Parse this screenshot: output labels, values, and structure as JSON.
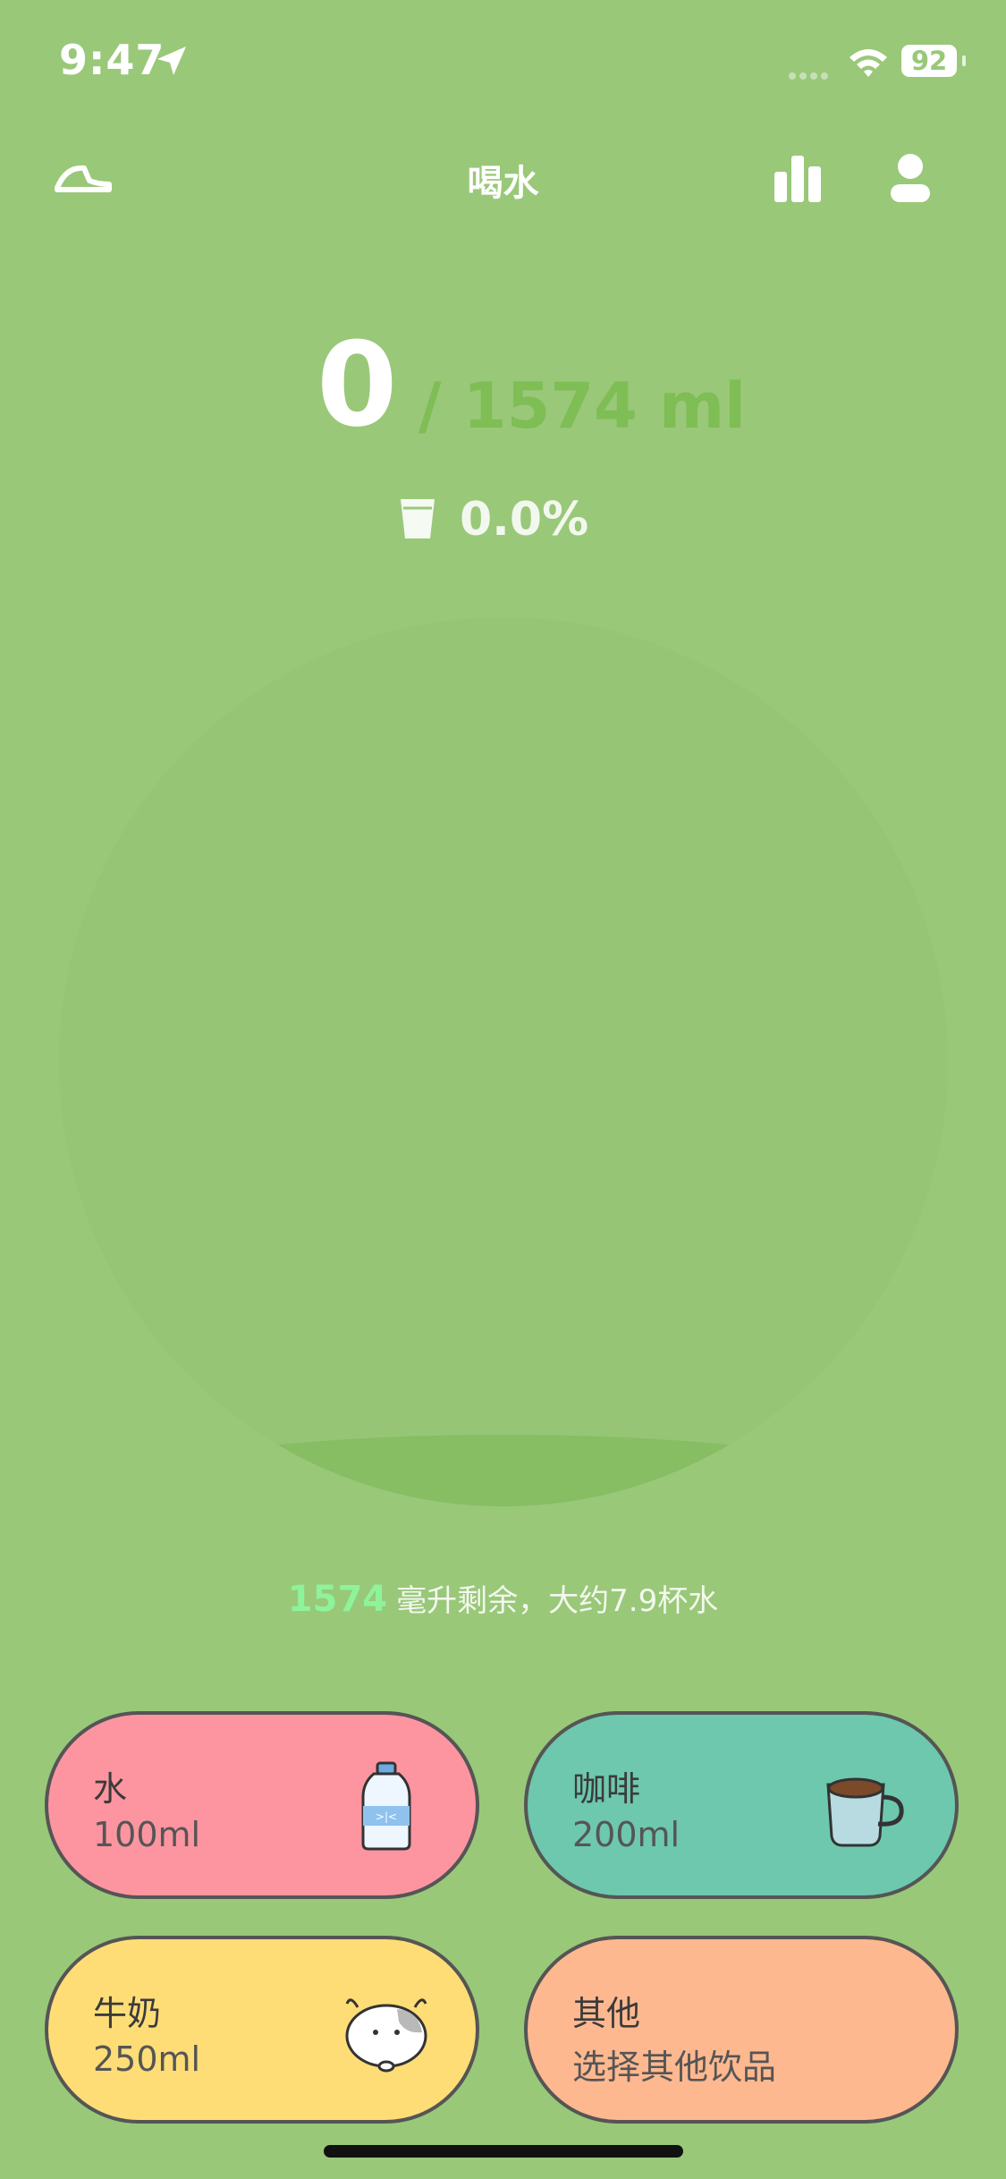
{
  "status_bar": {
    "time": "9:47",
    "battery": "92"
  },
  "header": {
    "title": "喝水"
  },
  "summary": {
    "drunk": "0",
    "goal": "/ 1574 ml",
    "percent": "0.0%"
  },
  "progress": {
    "fraction": 0.0
  },
  "remaining": {
    "amount": "1574",
    "text": "毫升剩余，大约7.9杯水"
  },
  "drinks": [
    {
      "name": "水",
      "amount": "100ml",
      "icon": "water-bottle-icon"
    },
    {
      "name": "咖啡",
      "amount": "200ml",
      "icon": "coffee-cup-icon"
    },
    {
      "name": "牛奶",
      "amount": "250ml",
      "icon": "cow-icon"
    },
    {
      "name": "其他",
      "amount": "选择其他饮品"
    }
  ],
  "colors": {
    "background": "#99c879",
    "water": "#fd95a0",
    "coffee": "#6dc8ae",
    "milk": "#fedd77",
    "other": "#feb88f",
    "remaining_number": "#8ef39a"
  }
}
